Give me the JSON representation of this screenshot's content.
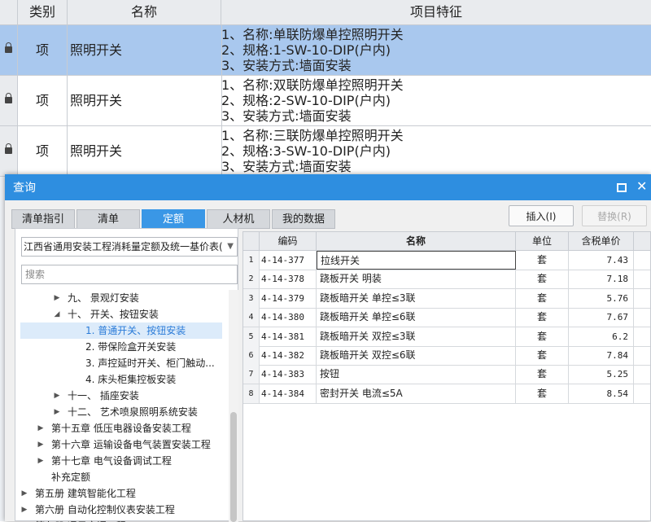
{
  "background_table": {
    "headers": {
      "type": "类别",
      "name": "名称",
      "feature": "项目特征"
    },
    "rows": [
      {
        "type": "项",
        "name": "照明开关",
        "features": [
          "1、名称:单联防爆单控照明开关",
          "2、规格:1-SW-10-DIP(户内)",
          "3、安装方式:墙面安装"
        ],
        "selected": true
      },
      {
        "type": "项",
        "name": "照明开关",
        "features": [
          "1、名称:双联防爆单控照明开关",
          "2、规格:2-SW-10-DIP(户内)",
          "3、安装方式:墙面安装"
        ],
        "selected": false
      },
      {
        "type": "项",
        "name": "照明开关",
        "features": [
          "1、名称:三联防爆单控照明开关",
          "2、规格:3-SW-10-DIP(户内)",
          "3、安装方式:墙面安装"
        ],
        "selected": false
      }
    ]
  },
  "dialog": {
    "title": "查询",
    "tabs": [
      {
        "label": "清单指引",
        "active": false
      },
      {
        "label": "清单",
        "active": false
      },
      {
        "label": "定额",
        "active": true
      },
      {
        "label": "人材机",
        "active": false
      },
      {
        "label": "我的数据",
        "active": false
      }
    ],
    "insert_label": "插入(I)",
    "replace_label": "替换(R)",
    "library_select": "江西省通用安装工程消耗量定额及统一基价表(",
    "search_placeholder": "搜索",
    "tree": [
      {
        "label": "九、 景观灯安装",
        "level": 3,
        "arrow": "right"
      },
      {
        "label": "十、 开关、按钮安装",
        "level": 3,
        "arrow": "down"
      },
      {
        "label": "1. 普通开关、按钮安装",
        "level": 4,
        "arrow": "",
        "selected": true
      },
      {
        "label": "2. 带保险盒开关安装",
        "level": 4,
        "arrow": ""
      },
      {
        "label": "3. 声控延时开关、柜门触动...",
        "level": 4,
        "arrow": ""
      },
      {
        "label": "4. 床头柜集控板安装",
        "level": 4,
        "arrow": ""
      },
      {
        "label": "十一、 插座安装",
        "level": 3,
        "arrow": "right"
      },
      {
        "label": "十二、 艺术喷泉照明系统安装",
        "level": 3,
        "arrow": "right"
      },
      {
        "label": "第十五章 低压电器设备安装工程",
        "level": 2,
        "arrow": "right"
      },
      {
        "label": "第十六章 运输设备电气装置安装工程",
        "level": 2,
        "arrow": "right"
      },
      {
        "label": "第十七章 电气设备调试工程",
        "level": 2,
        "arrow": "right"
      },
      {
        "label": "补充定额",
        "level": 2,
        "arrow": ""
      },
      {
        "label": "第五册 建筑智能化工程",
        "level": 1,
        "arrow": "right"
      },
      {
        "label": "第六册 自动化控制仪表安装工程",
        "level": 1,
        "arrow": "right"
      },
      {
        "label": "第七册 通风空调工程",
        "level": 1,
        "arrow": "right"
      }
    ],
    "grid_headers": {
      "code": "编码",
      "name": "名称",
      "unit": "单位",
      "price": "含税单价"
    },
    "grid_rows": [
      {
        "idx": "1",
        "code": "4-14-377",
        "name": "拉线开关",
        "unit": "套",
        "price": "7.43"
      },
      {
        "idx": "2",
        "code": "4-14-378",
        "name": "跷板开关 明装",
        "unit": "套",
        "price": "7.18"
      },
      {
        "idx": "3",
        "code": "4-14-379",
        "name": "跷板暗开关 单控≤3联",
        "unit": "套",
        "price": "5.76"
      },
      {
        "idx": "4",
        "code": "4-14-380",
        "name": "跷板暗开关 单控≤6联",
        "unit": "套",
        "price": "7.67"
      },
      {
        "idx": "5",
        "code": "4-14-381",
        "name": "跷板暗开关 双控≤3联",
        "unit": "套",
        "price": "6.2"
      },
      {
        "idx": "6",
        "code": "4-14-382",
        "name": "跷板暗开关 双控≤6联",
        "unit": "套",
        "price": "7.84"
      },
      {
        "idx": "7",
        "code": "4-14-383",
        "name": "按钮",
        "unit": "套",
        "price": "5.25"
      },
      {
        "idx": "8",
        "code": "4-14-384",
        "name": "密封开关 电流≤5A",
        "unit": "套",
        "price": "8.54"
      }
    ]
  }
}
